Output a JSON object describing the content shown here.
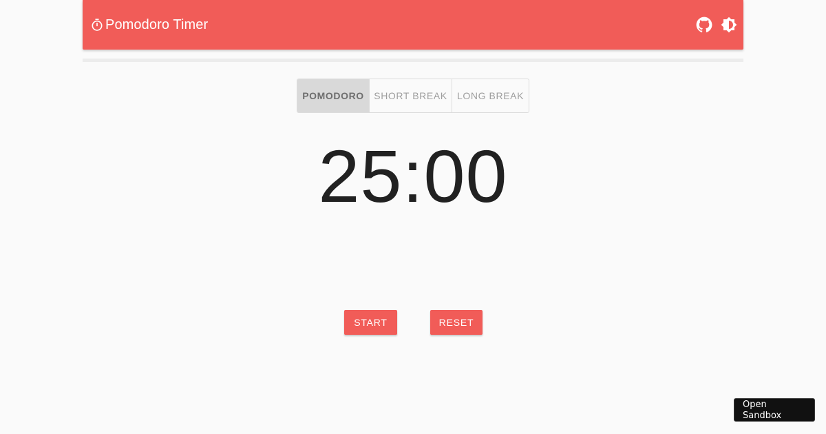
{
  "header": {
    "title": "Pomodoro Timer",
    "icons": {
      "brand": "timer-icon",
      "github": "github-icon",
      "theme": "brightness-icon"
    },
    "background_color": "#f15c58"
  },
  "progress": {
    "value_percent": 0
  },
  "modes": [
    {
      "label": "POMODORO",
      "active": true
    },
    {
      "label": "SHORT BREAK",
      "active": false
    },
    {
      "label": "LONG BREAK",
      "active": false
    }
  ],
  "timer": {
    "display": "25:00"
  },
  "controls": {
    "start_label": "START",
    "reset_label": "RESET"
  },
  "sandbox": {
    "label": "Open Sandbox"
  },
  "colors": {
    "accent": "#f15c58",
    "active_tab": "#d9d9d9"
  }
}
